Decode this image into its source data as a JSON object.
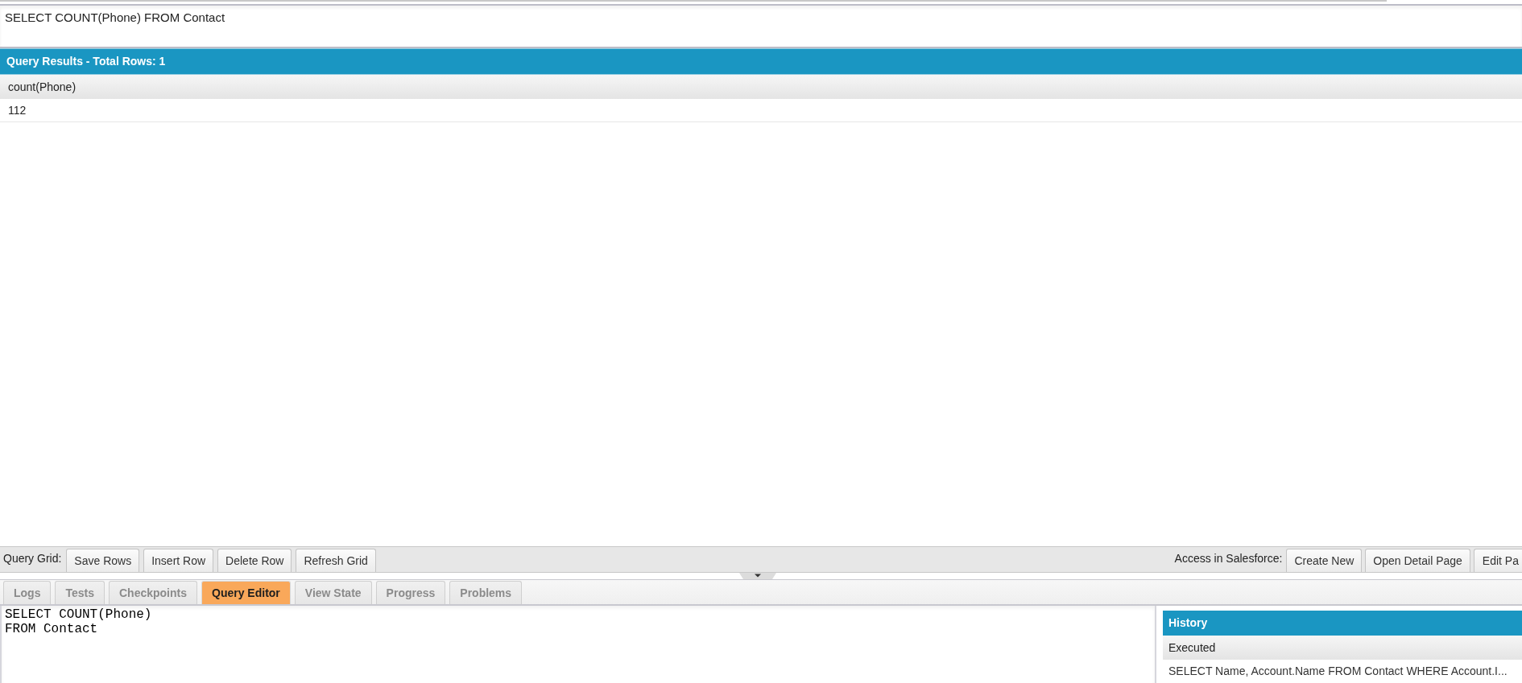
{
  "query_box": {
    "value": "SELECT COUNT(Phone) FROM Contact"
  },
  "results": {
    "title": "Query Results - Total Rows: 1",
    "columns": [
      "count(Phone)"
    ],
    "rows": [
      [
        "112"
      ]
    ]
  },
  "query_grid_toolbar": {
    "label": "Query Grid:",
    "buttons": [
      "Save Rows",
      "Insert Row",
      "Delete Row",
      "Refresh Grid"
    ]
  },
  "salesforce_toolbar": {
    "label": "Access in Salesforce:",
    "buttons": [
      "Create New",
      "Open Detail Page",
      "Edit Pa"
    ]
  },
  "tabs": [
    {
      "label": "Logs",
      "selected": false
    },
    {
      "label": "Tests",
      "selected": false
    },
    {
      "label": "Checkpoints",
      "selected": false
    },
    {
      "label": "Query Editor",
      "selected": true
    },
    {
      "label": "View State",
      "selected": false
    },
    {
      "label": "Progress",
      "selected": false
    },
    {
      "label": "Problems",
      "selected": false
    }
  ],
  "editor": {
    "lines": [
      "SELECT COUNT(Phone)",
      "FROM Contact"
    ]
  },
  "history": {
    "title": "History",
    "columns": [
      "Executed"
    ],
    "rows": [
      [
        "SELECT Name, Account.Name FROM Contact WHERE Account.I..."
      ]
    ]
  }
}
